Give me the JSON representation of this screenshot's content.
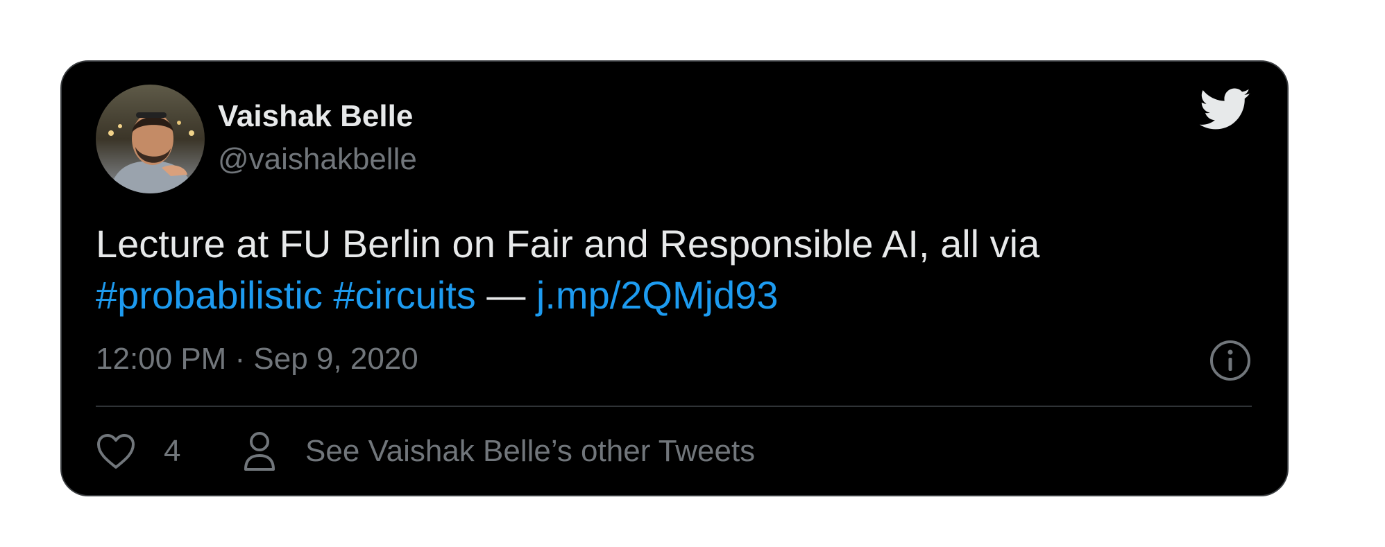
{
  "author": {
    "name": "Vaishak Belle",
    "handle": "@vaishakbelle",
    "avatar": "avatar-photo"
  },
  "brand_icon": "twitter-bird-icon",
  "tweet": {
    "text_intro": "Lecture at FU Berlin on Fair and Responsible AI, all via",
    "hashtag_1": "#probabilistic",
    "hashtag_2": "#circuits",
    "separator": "—",
    "link": "j.mp/2QMjd93",
    "timestamp": "12:00 PM · Sep 9, 2020"
  },
  "actions": {
    "like_icon": "heart-icon",
    "like_count": "4",
    "profile_icon": "person-icon",
    "other_tweets_label": "See Vaishak Belle’s other Tweets",
    "info_icon": "info-icon"
  },
  "colors": {
    "card_background": "#000000",
    "link_color": "#1d9bf0",
    "primary_text": "#e7e9ea",
    "secondary_text": "#71767b",
    "border": "#3a3d40"
  }
}
